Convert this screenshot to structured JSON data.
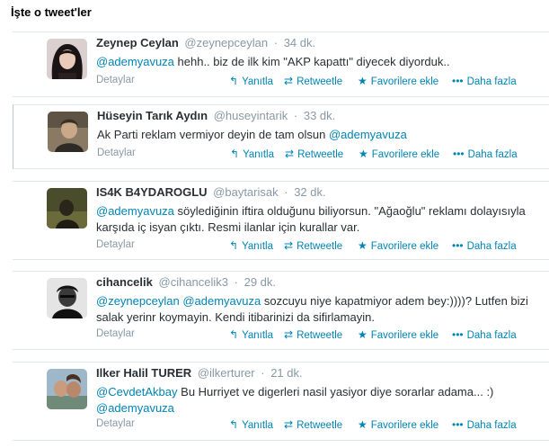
{
  "page": {
    "title": "İşte o tweet'ler"
  },
  "actions": {
    "details": "Detaylar",
    "reply": "Yanıtla",
    "retweet": "Retweetle",
    "favorite": "Favorilere ekle",
    "more": "Daha fazla",
    "icons": {
      "reply": "reply-arrow-icon",
      "retweet": "retweet-icon",
      "favorite": "star-icon",
      "more": "ellipsis-icon"
    }
  },
  "tweets": [
    {
      "name": "Zeynep Ceylan",
      "handle": "@zeynepceylan",
      "time": "34 dk.",
      "text": [
        "@ademyavuza",
        " hehh.. biz de ilk kim \"AKP kapattı\" diyecek diyorduk.."
      ]
    },
    {
      "name": "Hüseyin Tarık Aydın",
      "handle": "@huseyintarik",
      "time": "33 dk.",
      "text": [
        "Ak Parti reklam vermiyor deyin de tam olsun ",
        "@ademyavuza"
      ]
    },
    {
      "name": "IS4K B4YDAROGLU",
      "handle": "@baytarisak",
      "time": "32 dk.",
      "text": [
        "@ademyavuza",
        " söylediğinin iftira olduğunu biliyorsun. \"Ağaoğlu\" reklamı dolayısıyla karşıda iç isyan çıktı. Resmi ilanlar için kurallar var."
      ]
    },
    {
      "name": "cihancelik",
      "handle": "@cihancelik3",
      "time": "29 dk.",
      "text": [
        "@zeynepceylan",
        " ",
        "@ademyavuza",
        " sozcuyu niye kapatmiyor adem bey:))))? Lutfen bizi salak yerinr koymayin. Kendi itibarinizi da sifirlamayin."
      ]
    },
    {
      "name": "Ilker Halil TURER",
      "handle": "@ilkerturer",
      "time": "21 dk.",
      "text": [
        "@CevdetAkbay",
        " Bu Hurriyet ve digerleri nasil yasiyor diye sorarlar adama... :) ",
        "@ademyavuza"
      ]
    }
  ]
}
